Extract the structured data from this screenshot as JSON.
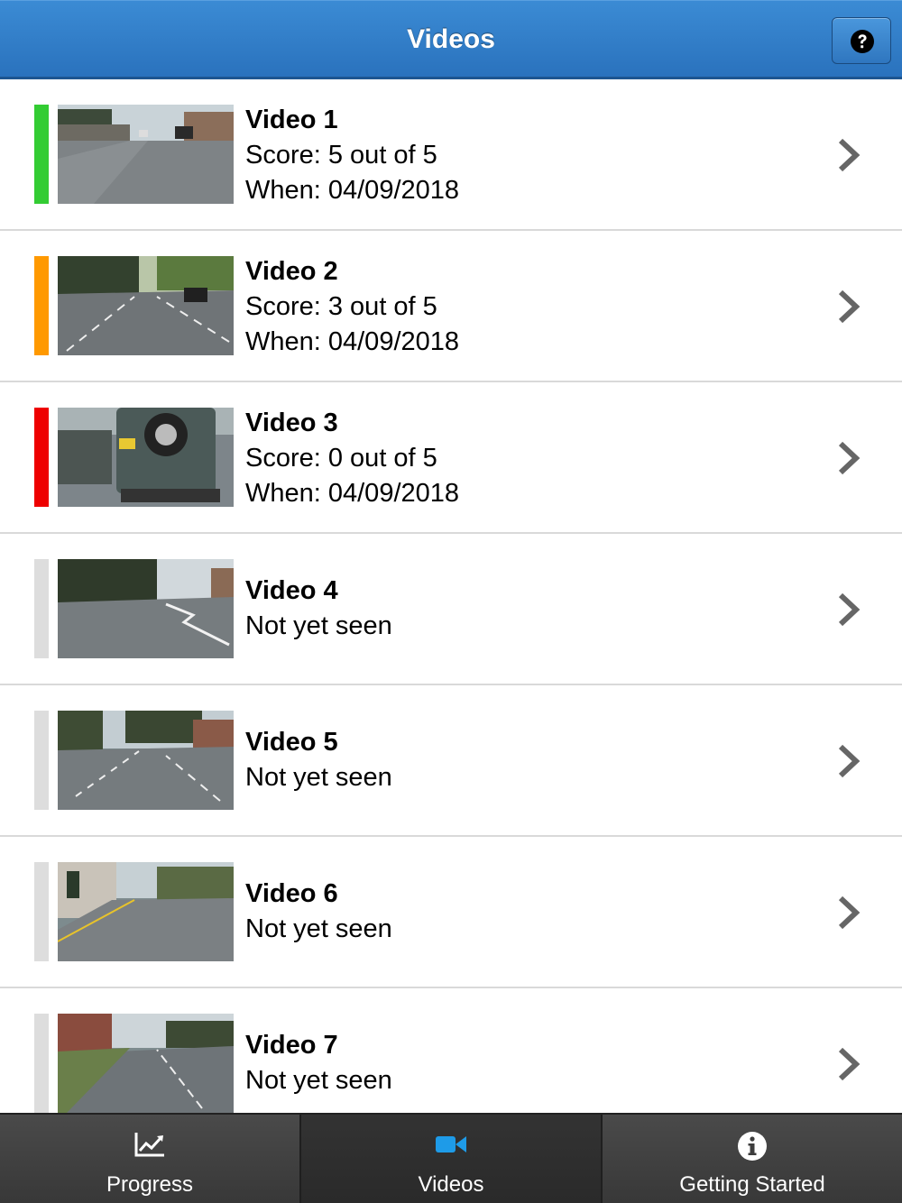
{
  "header": {
    "title": "Videos",
    "help_icon": "question-circle-icon",
    "accent": "#2f7cc6"
  },
  "videos": [
    {
      "title": "Video 1",
      "line2": "Score:  5 out of 5",
      "line3": "When:  04/09/2018",
      "status": "full",
      "status_color": "#33cc33"
    },
    {
      "title": "Video 2",
      "line2": "Score:  3 out of 5",
      "line3": "When:  04/09/2018",
      "status": "partial",
      "status_color": "#ff9900"
    },
    {
      "title": "Video 3",
      "line2": "Score:  0 out of 5",
      "line3": "When:  04/09/2018",
      "status": "none",
      "status_color": "#ee0000"
    },
    {
      "title": "Video 4",
      "line2": "Not yet seen",
      "status": "unseen",
      "status_color": "#dddddd"
    },
    {
      "title": "Video 5",
      "line2": "Not yet seen",
      "status": "unseen",
      "status_color": "#dddddd"
    },
    {
      "title": "Video 6",
      "line2": "Not yet seen",
      "status": "unseen",
      "status_color": "#dddddd"
    },
    {
      "title": "Video 7",
      "line2": "Not yet seen",
      "status": "unseen",
      "status_color": "#dddddd"
    }
  ],
  "tabbar": {
    "tabs": [
      {
        "label": "Progress",
        "icon": "line-chart-icon",
        "active": false
      },
      {
        "label": "Videos",
        "icon": "video-camera-icon",
        "active": true
      },
      {
        "label": "Getting Started",
        "icon": "info-circle-icon",
        "active": false
      }
    ],
    "active_color": "#1e9be8"
  }
}
